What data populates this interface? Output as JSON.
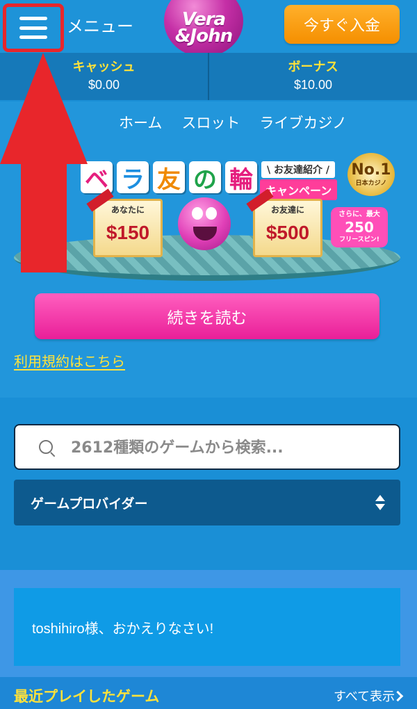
{
  "header": {
    "menu_label": "メニュー",
    "logo_line1": "Vera",
    "logo_line2": "&John",
    "deposit_label": "今すぐ入金"
  },
  "balance": {
    "cash_label": "キャッシュ",
    "cash_value": "$0.00",
    "bonus_label": "ボーナス",
    "bonus_value": "$10.00"
  },
  "nav": {
    "items": [
      "ホーム",
      "スロット",
      "ライブカジノ"
    ]
  },
  "banner": {
    "title_chars": [
      "ベ",
      "ラ",
      "友",
      "の",
      "輪"
    ],
    "title_colors": [
      "#e51e7e",
      "#1d8fe0",
      "#f08a00",
      "#1fa34a",
      "#e51e7e"
    ],
    "campaign_top": "\\ お友達紹介 /",
    "campaign_bottom": "キャンペーン",
    "no1_big": "No.1",
    "no1_small": "日本カジノ",
    "offer_you_label": "あなたに",
    "offer_you_amount": "$150",
    "offer_friend_label": "お友達に",
    "offer_friend_amount": "$500",
    "spins_line1": "さらに、最大",
    "spins_line2": "250",
    "spins_line3": "フリースピン!"
  },
  "promo": {
    "read_more_label": "続きを読む",
    "terms_link": "利用規約はこちら"
  },
  "search": {
    "placeholder": "2612種類のゲームから検索..."
  },
  "provider": {
    "label": "ゲームプロバイダー"
  },
  "welcome": {
    "message": "toshihiro様、おかえりなさい!"
  },
  "recent": {
    "title": "最近プレイしたゲーム",
    "show_all": "すべて表示"
  },
  "colors": {
    "highlight_outline": "#e8262b",
    "accent_yellow": "#ffe23a",
    "deposit_orange": "#f7a114",
    "cta_pink": "#f23ba8"
  }
}
